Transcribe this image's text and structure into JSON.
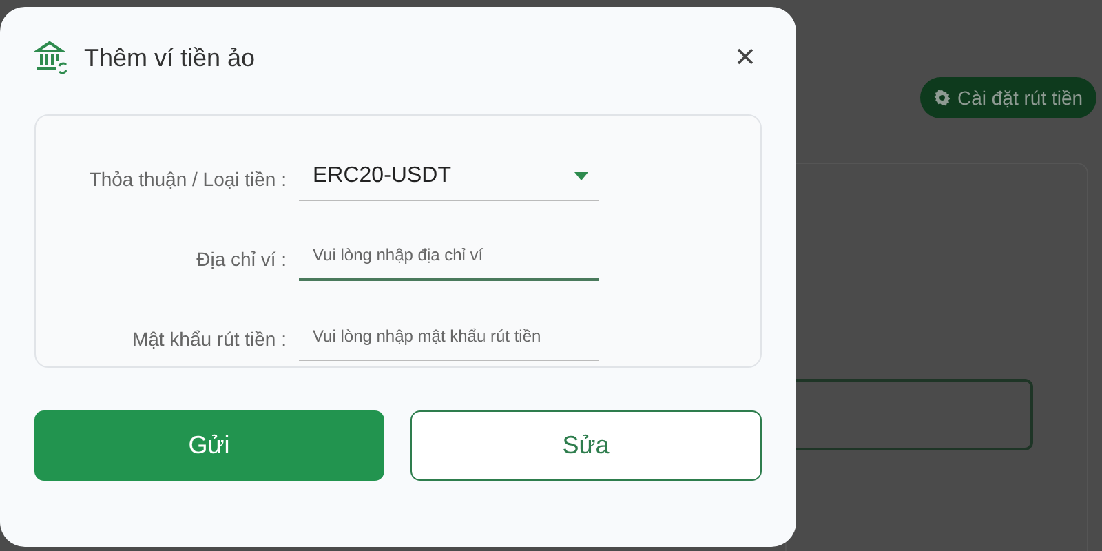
{
  "background": {
    "settings_button": {
      "label": "Cài đặt rút tiền"
    }
  },
  "dialog": {
    "title": "Thêm ví tiền ảo",
    "fields": [
      {
        "kind": "select",
        "label": "Thỏa thuận / Loại tiền :",
        "value": "ERC20-USDT",
        "focused": false
      },
      {
        "kind": "input",
        "label": "Địa chỉ ví :",
        "placeholder": "Vui lòng nhập địa chỉ ví",
        "focused": true
      },
      {
        "kind": "input",
        "label": "Mật khẩu rút tiền :",
        "placeholder": "Vui lòng nhập mật khẩu rút tiền",
        "focused": false
      }
    ],
    "buttons": [
      {
        "kind": "primary",
        "label": "Gửi"
      },
      {
        "kind": "outline",
        "label": "Sửa"
      }
    ]
  }
}
